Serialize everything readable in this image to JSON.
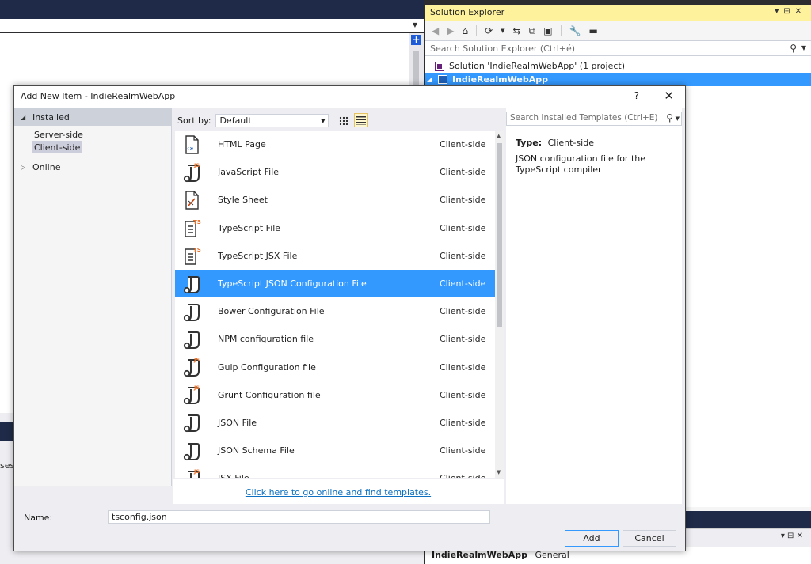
{
  "ide": {
    "output_fragment": "ses"
  },
  "solution_explorer": {
    "title": "Solution Explorer",
    "search_placeholder": "Search Solution Explorer (Ctrl+é)",
    "solution_label": "Solution 'IndieRealmWebApp' (1 project)",
    "project_label": "IndieRealmWebApp"
  },
  "properties": {
    "object_name": "IndieRealmWebApp",
    "object_type": "General"
  },
  "dialog": {
    "title": "Add New Item - IndieRealmWebApp",
    "help": "?",
    "close": "✕",
    "categories": {
      "installed": "Installed",
      "server_side": "Server-side",
      "client_side": "Client-side",
      "online": "Online"
    },
    "sort_label": "Sort by:",
    "sort_value": "Default",
    "search_placeholder": "Search Installed Templates (Ctrl+E)",
    "templates": [
      {
        "name": "HTML Page",
        "category": "Client-side",
        "icon": "html-file-icon"
      },
      {
        "name": "JavaScript File",
        "category": "Client-side",
        "icon": "js-file-icon"
      },
      {
        "name": "Style Sheet",
        "category": "Client-side",
        "icon": "stylesheet-icon"
      },
      {
        "name": "TypeScript File",
        "category": "Client-side",
        "icon": "ts-file-icon"
      },
      {
        "name": "TypeScript JSX File",
        "category": "Client-side",
        "icon": "ts-file-icon"
      },
      {
        "name": "TypeScript JSON Configuration File",
        "category": "Client-side",
        "icon": "json-config-icon"
      },
      {
        "name": "Bower Configuration File",
        "category": "Client-side",
        "icon": "json-config-icon"
      },
      {
        "name": "NPM configuration file",
        "category": "Client-side",
        "icon": "json-config-icon"
      },
      {
        "name": "Gulp Configuration file",
        "category": "Client-side",
        "icon": "js-config-icon"
      },
      {
        "name": "Grunt Configuration file",
        "category": "Client-side",
        "icon": "js-config-icon"
      },
      {
        "name": "JSON File",
        "category": "Client-side",
        "icon": "json-config-icon"
      },
      {
        "name": "JSON Schema File",
        "category": "Client-side",
        "icon": "json-config-icon"
      },
      {
        "name": "JSX File",
        "category": "Client-side",
        "icon": "jsx-file-icon"
      }
    ],
    "selected_index": 5,
    "details": {
      "type_label": "Type:",
      "type_value": "Client-side",
      "description": "JSON configuration file for the TypeScript compiler"
    },
    "online_link": "Click here to go online and find templates.",
    "name_label": "Name:",
    "name_value": "tsconfig.json",
    "add_label": "Add",
    "cancel_label": "Cancel"
  },
  "colors": {
    "selection": "#3399ff",
    "ide_dark": "#1e2a47",
    "solution_explorer_title": "#fff29d",
    "link": "#0e70c0"
  }
}
